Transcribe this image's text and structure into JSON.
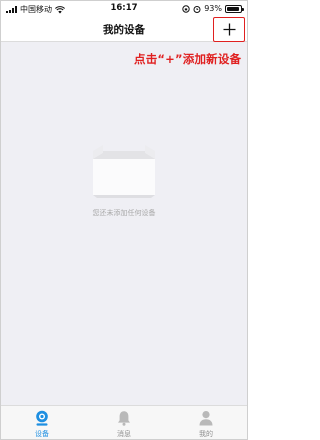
{
  "status_bar": {
    "carrier": "中国移动",
    "time": "16:17",
    "battery_percent": "93%",
    "battery_level": 0.93
  },
  "nav": {
    "title": "我的设备",
    "add_icon": "plus-icon"
  },
  "annotation": {
    "text": "点击“+”添加新设备",
    "color": "#e02020"
  },
  "empty_state": {
    "icon": "empty-box-icon",
    "message": "您还未添加任何设备"
  },
  "tab_bar": {
    "tabs": [
      {
        "label": "设备",
        "icon": "camera-icon",
        "active": true
      },
      {
        "label": "消息",
        "icon": "bell-icon",
        "active": false
      },
      {
        "label": "我的",
        "icon": "person-icon",
        "active": false
      }
    ]
  },
  "colors": {
    "accent": "#1e8fe1",
    "background": "#efeff4",
    "tab_inactive": "#8f8f8f"
  }
}
